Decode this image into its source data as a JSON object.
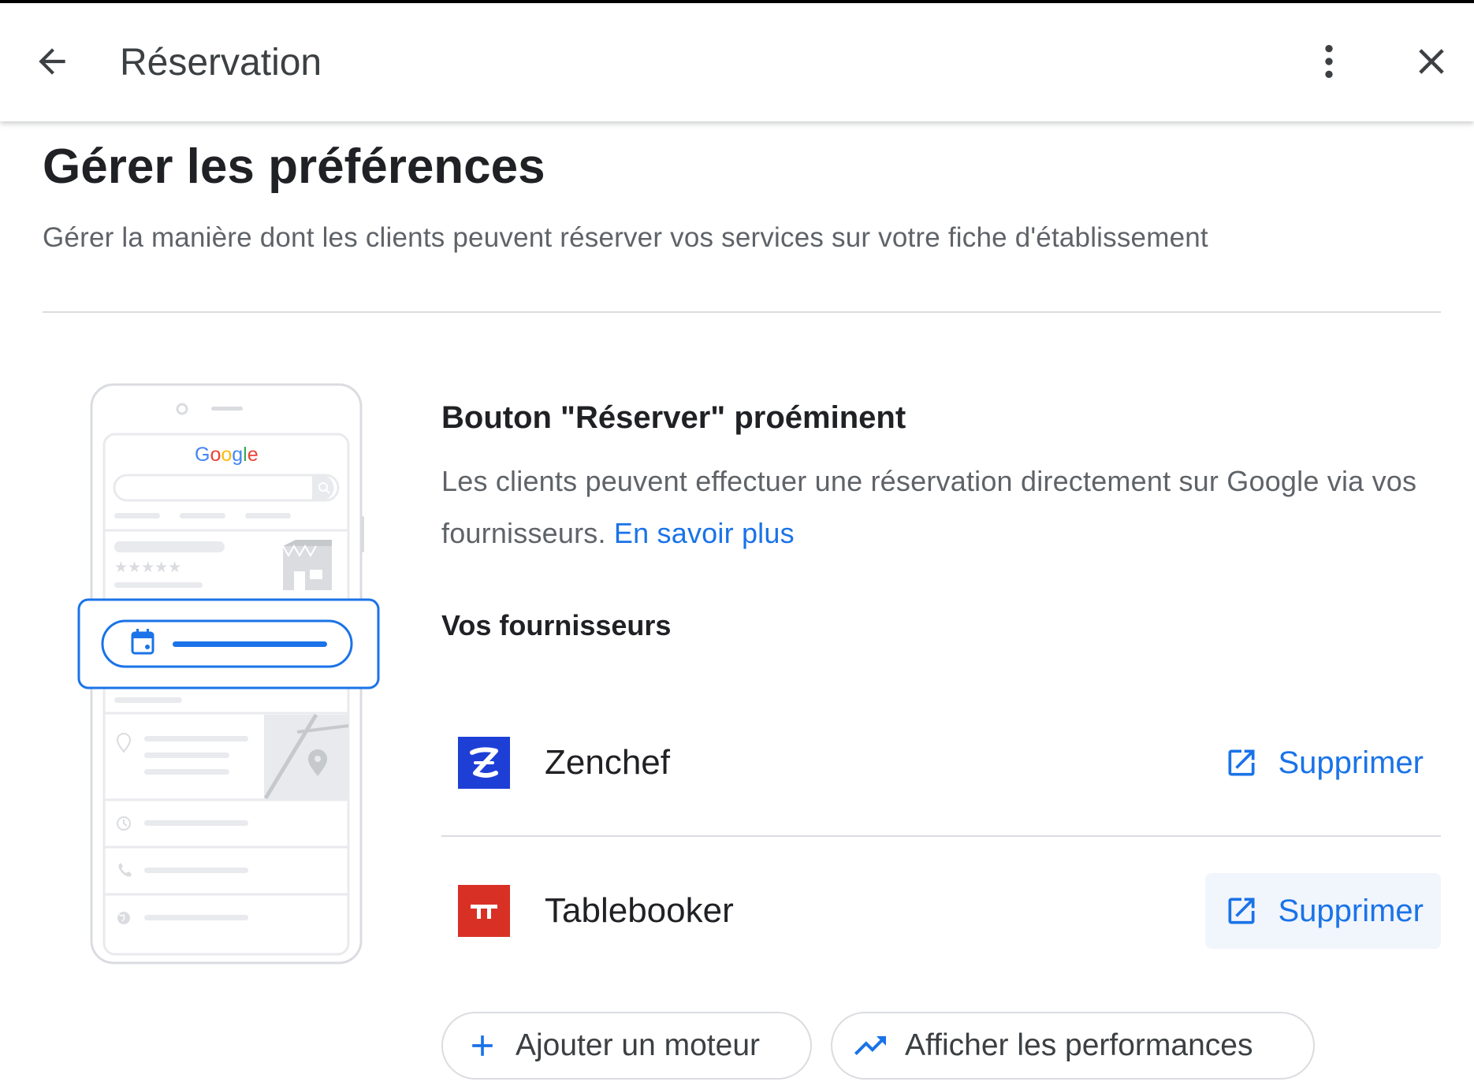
{
  "appbar": {
    "title": "Réservation",
    "back_icon": "arrow-back-icon",
    "more_icon": "more-vert-icon",
    "close_icon": "close-icon"
  },
  "page": {
    "title": "Gérer les préférences",
    "subtitle": "Gérer la manière dont les clients peuvent réserver vos services sur votre fiche d'établissement"
  },
  "illustration": {
    "google_logo_text": "Google",
    "colors": {
      "blue": "#4285F4",
      "red": "#EA4335",
      "yellow": "#FBBC05",
      "green": "#34A853",
      "accent": "#1a73e8"
    }
  },
  "booking": {
    "title": "Bouton \"Réserver\" proéminent",
    "description": "Les clients peuvent effectuer une réservation directement sur Google via vos fournisseurs.",
    "learn_more": "En savoir plus"
  },
  "providers": {
    "title": "Vos fournisseurs",
    "items": [
      {
        "name": "Zenchef",
        "logo_color": "#1e3fd6",
        "logo_icon": "zenchef-logo",
        "action_label": "Supprimer",
        "action_icon": "open-in-new-icon"
      },
      {
        "name": "Tablebooker",
        "logo_color": "#d93025",
        "logo_icon": "tablebooker-logo",
        "action_label": "Supprimer",
        "action_icon": "open-in-new-icon"
      }
    ]
  },
  "actions": {
    "add_engine": {
      "label": "Ajouter un moteur",
      "icon": "add-icon"
    },
    "performance": {
      "label": "Afficher les performances",
      "icon": "trending-up-icon"
    }
  }
}
